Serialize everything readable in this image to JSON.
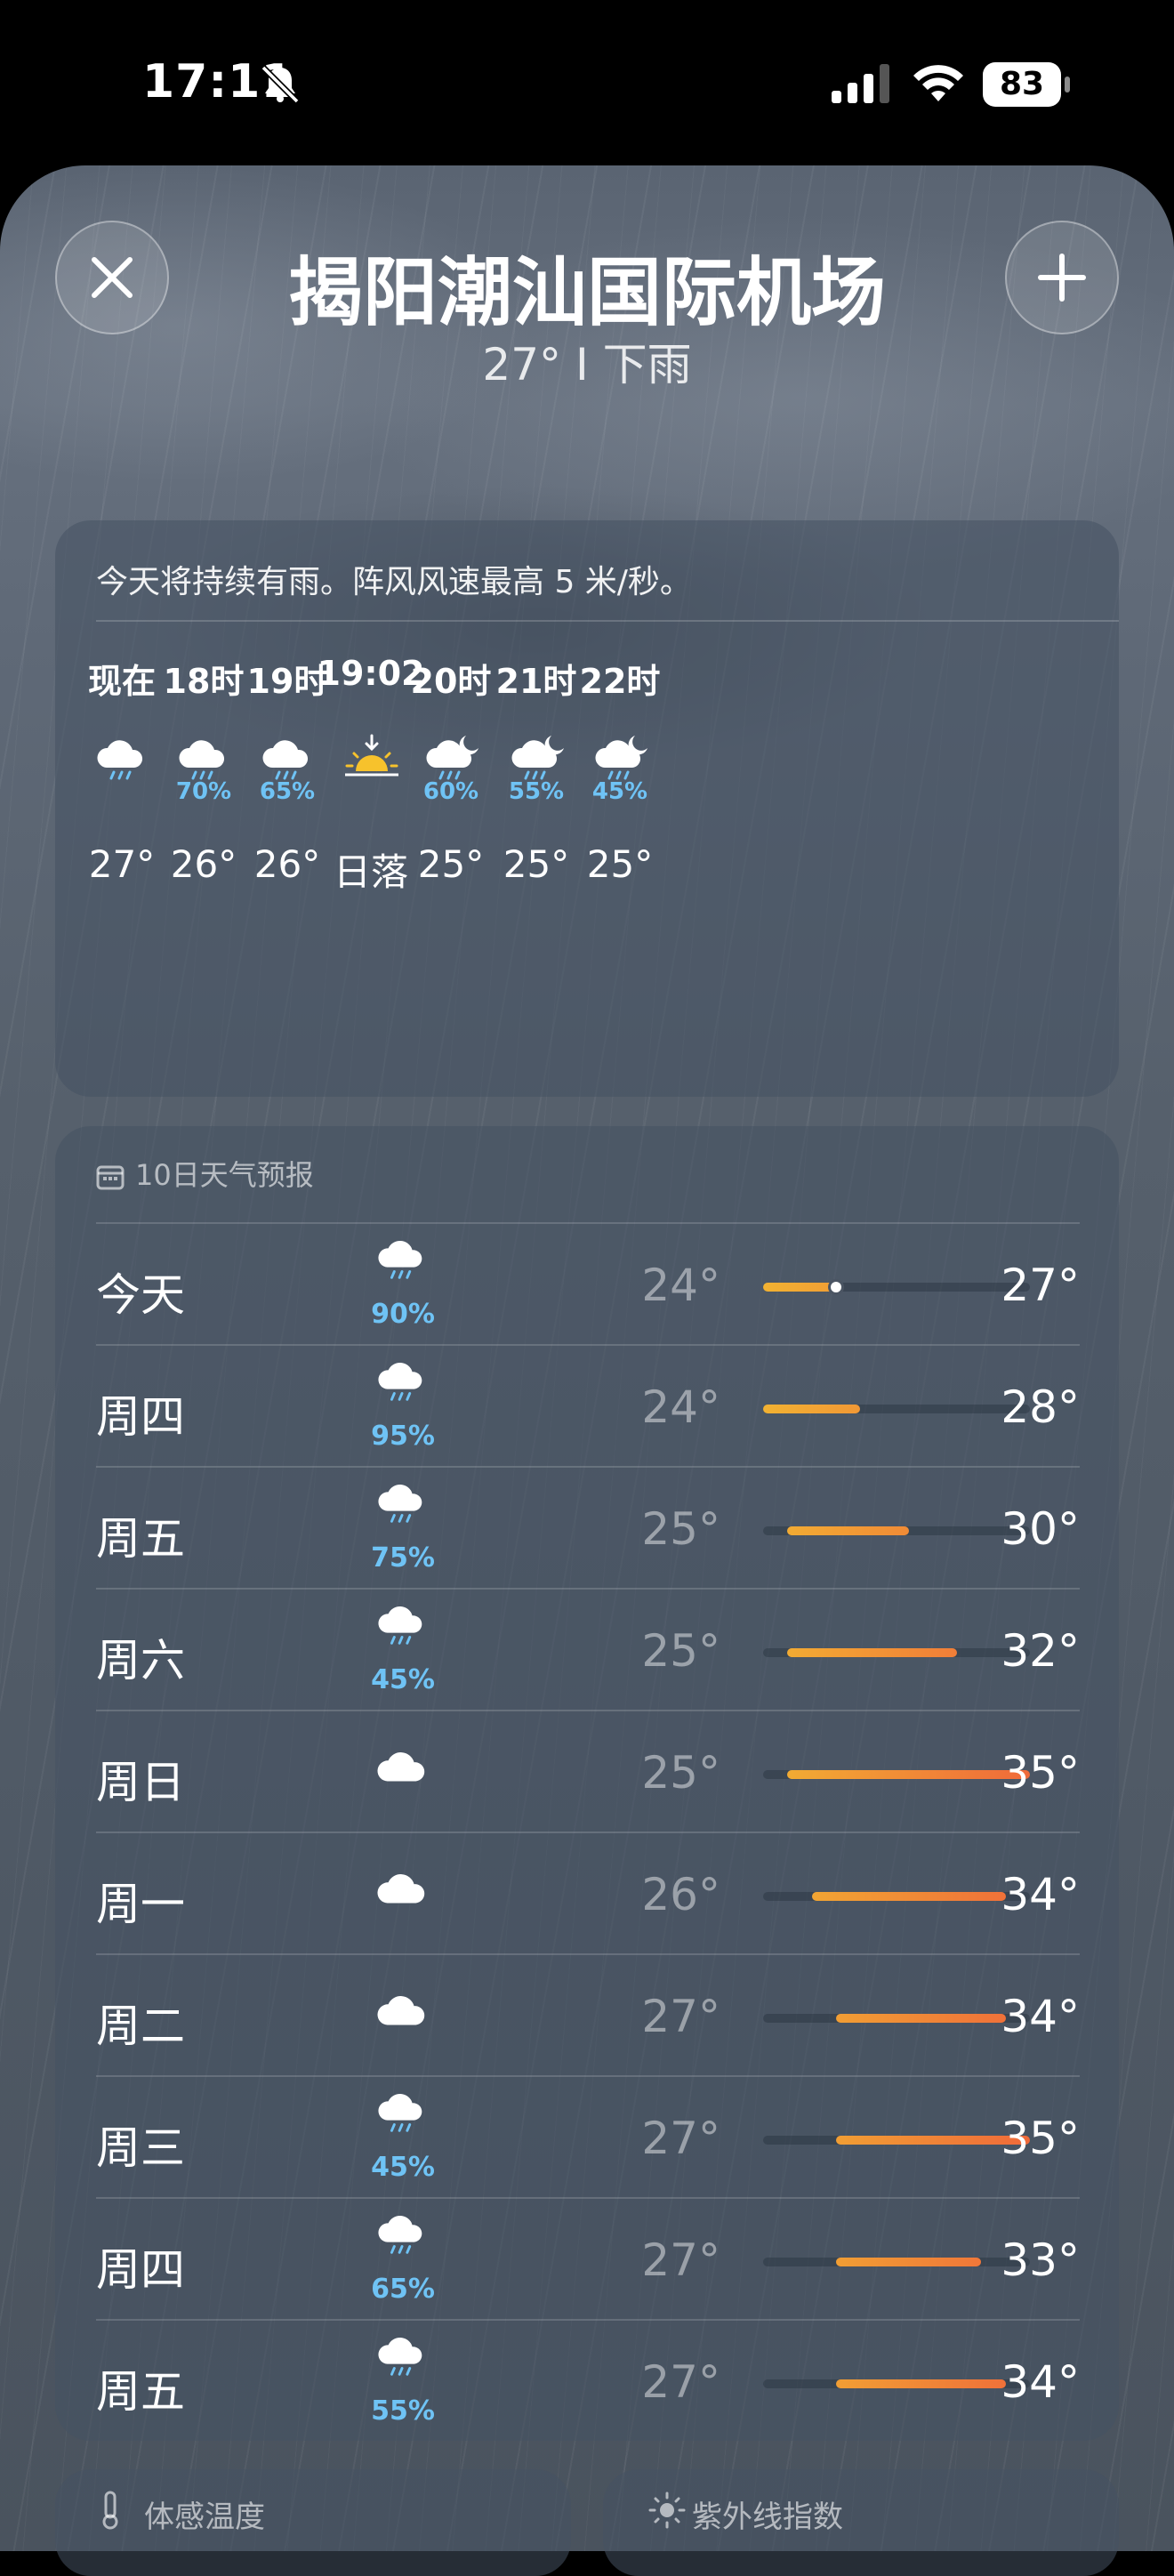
{
  "status_bar": {
    "time": "17:11",
    "battery": "83"
  },
  "location": {
    "name": "揭阳潮汕国际机场",
    "current": "27° I 下雨"
  },
  "hourly": {
    "summary": "今天将持续有雨。阵风风速最高 5 米/秒。",
    "items": [
      {
        "time": "现在",
        "icon": "rain-icon",
        "precip": "",
        "temp": "27°"
      },
      {
        "time": "18时",
        "icon": "rain-icon",
        "precip": "70%",
        "temp": "26°"
      },
      {
        "time": "19时",
        "icon": "rain-icon",
        "precip": "65%",
        "temp": "26°"
      },
      {
        "time": "19:02",
        "icon": "sunset-icon",
        "precip": "",
        "temp": "日落"
      },
      {
        "time": "20时",
        "icon": "night-rain-icon",
        "precip": "60%",
        "temp": "25°"
      },
      {
        "time": "21时",
        "icon": "night-rain-icon",
        "precip": "55%",
        "temp": "25°"
      },
      {
        "time": "22时",
        "icon": "night-rain-icon",
        "precip": "45%",
        "temp": "25°"
      }
    ]
  },
  "daily": {
    "title": "10日天气预报",
    "range": [
      24,
      35
    ],
    "current_temp": 27,
    "items": [
      {
        "day": "今天",
        "icon": "rain-icon",
        "precip": "90%",
        "low": "24°",
        "high": "27°",
        "lo": 24,
        "hi": 27
      },
      {
        "day": "周四",
        "icon": "rain-icon",
        "precip": "95%",
        "low": "24°",
        "high": "28°",
        "lo": 24,
        "hi": 28
      },
      {
        "day": "周五",
        "icon": "rain-icon",
        "precip": "75%",
        "low": "25°",
        "high": "30°",
        "lo": 25,
        "hi": 30
      },
      {
        "day": "周六",
        "icon": "rain-icon",
        "precip": "45%",
        "low": "25°",
        "high": "32°",
        "lo": 25,
        "hi": 32
      },
      {
        "day": "周日",
        "icon": "cloud-icon",
        "precip": "",
        "low": "25°",
        "high": "35°",
        "lo": 25,
        "hi": 35
      },
      {
        "day": "周一",
        "icon": "cloud-icon",
        "precip": "",
        "low": "26°",
        "high": "34°",
        "lo": 26,
        "hi": 34
      },
      {
        "day": "周二",
        "icon": "cloud-icon",
        "precip": "",
        "low": "27°",
        "high": "34°",
        "lo": 27,
        "hi": 34
      },
      {
        "day": "周三",
        "icon": "rain-icon",
        "precip": "45%",
        "low": "27°",
        "high": "35°",
        "lo": 27,
        "hi": 35
      },
      {
        "day": "周四",
        "icon": "rain-icon",
        "precip": "65%",
        "low": "27°",
        "high": "33°",
        "lo": 27,
        "hi": 33
      },
      {
        "day": "周五",
        "icon": "rain-icon",
        "precip": "55%",
        "low": "27°",
        "high": "34°",
        "lo": 27,
        "hi": 34
      }
    ]
  },
  "bottom_cards": {
    "feels_like": "体感温度",
    "uv": "紫外线指数"
  },
  "colors": {
    "precip": "#6fc3f5",
    "bar_cool": "#f2b232",
    "bar_warm": "#f06a3a"
  }
}
